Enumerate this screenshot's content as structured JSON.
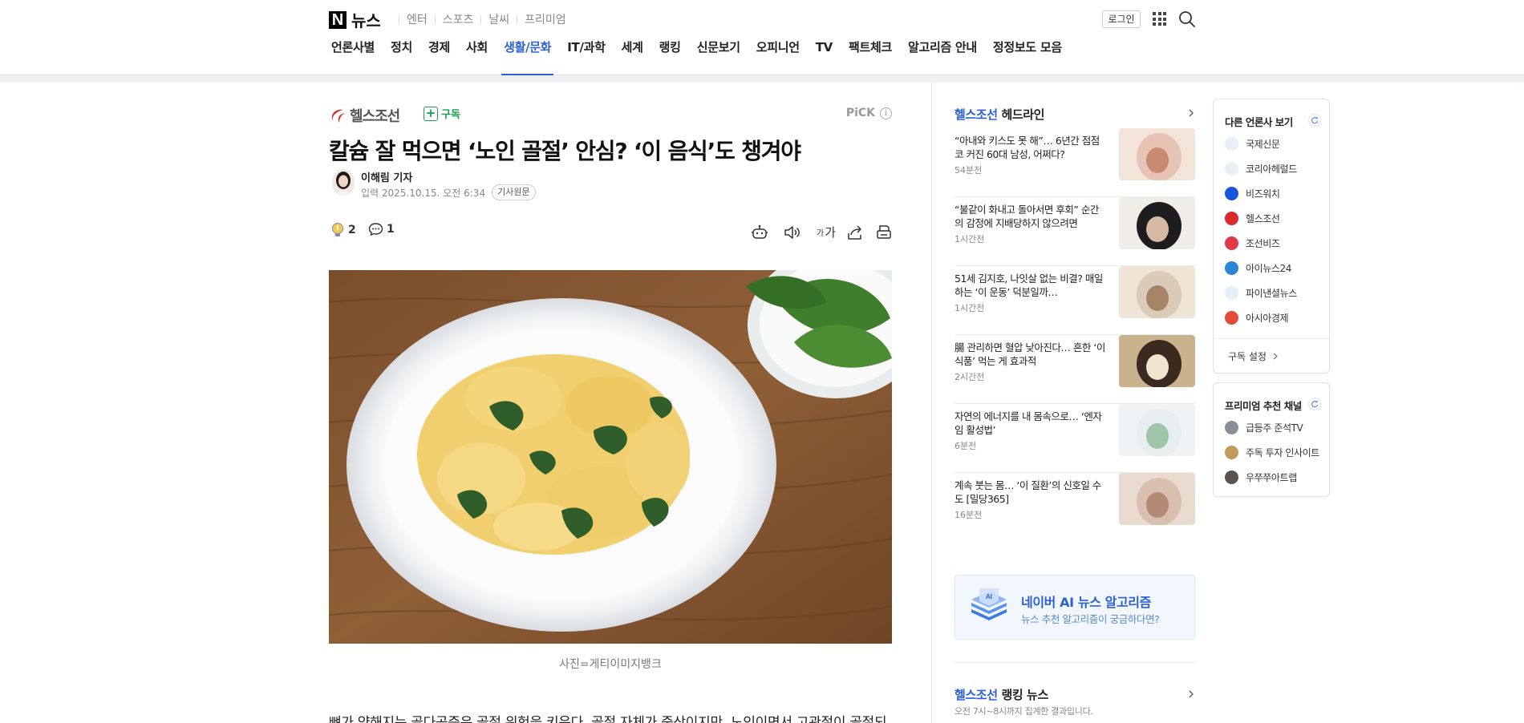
{
  "header": {
    "logo_text": "뉴스",
    "services": [
      "엔터",
      "스포츠",
      "날씨",
      "프리미엄"
    ],
    "login_label": "로그인"
  },
  "nav": {
    "items": [
      {
        "label": "언론사별",
        "active": false
      },
      {
        "label": "정치",
        "active": false
      },
      {
        "label": "경제",
        "active": false
      },
      {
        "label": "사회",
        "active": false
      },
      {
        "label": "생활/문화",
        "active": true
      },
      {
        "label": "IT/과학",
        "active": false
      },
      {
        "label": "세계",
        "active": false
      },
      {
        "label": "랭킹",
        "active": false
      },
      {
        "label": "신문보기",
        "active": false
      },
      {
        "label": "오피니언",
        "active": false
      },
      {
        "label": "TV",
        "active": false
      },
      {
        "label": "팩트체크",
        "active": false
      },
      {
        "label": "알고리즘 안내",
        "active": false
      },
      {
        "label": "정정보도 모음",
        "active": false
      }
    ]
  },
  "article": {
    "press_name": "헬스조선",
    "subscribe_label": "구독",
    "pick_label": "PiCK",
    "headline": "칼슘 잘 먹으면 ‘노인 골절’ 안심? ‘이 음식’도 챙겨야",
    "reporter": "이해림 기자",
    "date": "입력 2025.10.15. 오전 6:34",
    "origin_label": "기사원문",
    "reactions": {
      "likes": "2",
      "comments": "1"
    },
    "font_size_label": "가",
    "caption": "사진=게티이미지뱅크",
    "body_first_line": "뼈가 약해지는 골다공증은 골절 위험을 키운다. 골절 자체가 중상이지만, 노인이면서 고관절이 골절되"
  },
  "headlines": {
    "brand": "헬스조선",
    "title": "헤드라인",
    "items": [
      {
        "title": "“아내와 키스도 못 해”… 6년간 점점 코 커진 60대 남성, 어쩌다?",
        "time": "54분전"
      },
      {
        "title": "“불같이 화내고 돌아서면 후회” 순간의 감정에 지배당하지 않으려면",
        "time": "1시간전"
      },
      {
        "title": "51세 김지호, 나잇살 없는 비결? 매일 하는 ‘이 운동’ 덕분일까…",
        "time": "1시간전"
      },
      {
        "title": "腸 관리하면 혈압 낮아진다… 흔한 ‘이 식품’ 먹는 게 효과적",
        "time": "2시간전"
      },
      {
        "title": "자연의 에너지를 내 몸속으로… ‘엔자임 활성법’",
        "time": "6분전"
      },
      {
        "title": "계속 붓는 몸… ‘이 질환’의 신호일 수도 [밀당365]",
        "time": "16분전"
      }
    ]
  },
  "ai_banner": {
    "title": "네이버 AI 뉴스 알고리즘",
    "subtitle": "뉴스 추천 알고리즘이 궁금하다면?"
  },
  "ranking": {
    "brand": "헬스조선",
    "title": "랭킹 뉴스",
    "description": "오전 7시~8시까지 집계한 결과입니다."
  },
  "other_press": {
    "title": "다른 언론사 보기",
    "items": [
      {
        "name": "국제신문",
        "color": "#e8eef8"
      },
      {
        "name": "코리아헤럴드",
        "color": "#e8f0f4"
      },
      {
        "name": "비즈워치",
        "color": "#1a56db"
      },
      {
        "name": "헬스조선",
        "color": "#d62b2b"
      },
      {
        "name": "조선비즈",
        "color": "#e03a4a"
      },
      {
        "name": "아이뉴스24",
        "color": "#2a86d8"
      },
      {
        "name": "파이낸셜뉴스",
        "color": "#e6eefa"
      },
      {
        "name": "아시아경제",
        "color": "#e44b3a"
      }
    ],
    "settings_label": "구독 설정"
  },
  "premium": {
    "title": "프리미엄 추천 채널",
    "items": [
      {
        "name": "급등주 준석TV"
      },
      {
        "name": "주독 투자 인사이트"
      },
      {
        "name": "우쭈쭈아트랩"
      }
    ]
  },
  "colors": {
    "accent": "#2d60d6",
    "subscribe": "#16a34a"
  }
}
